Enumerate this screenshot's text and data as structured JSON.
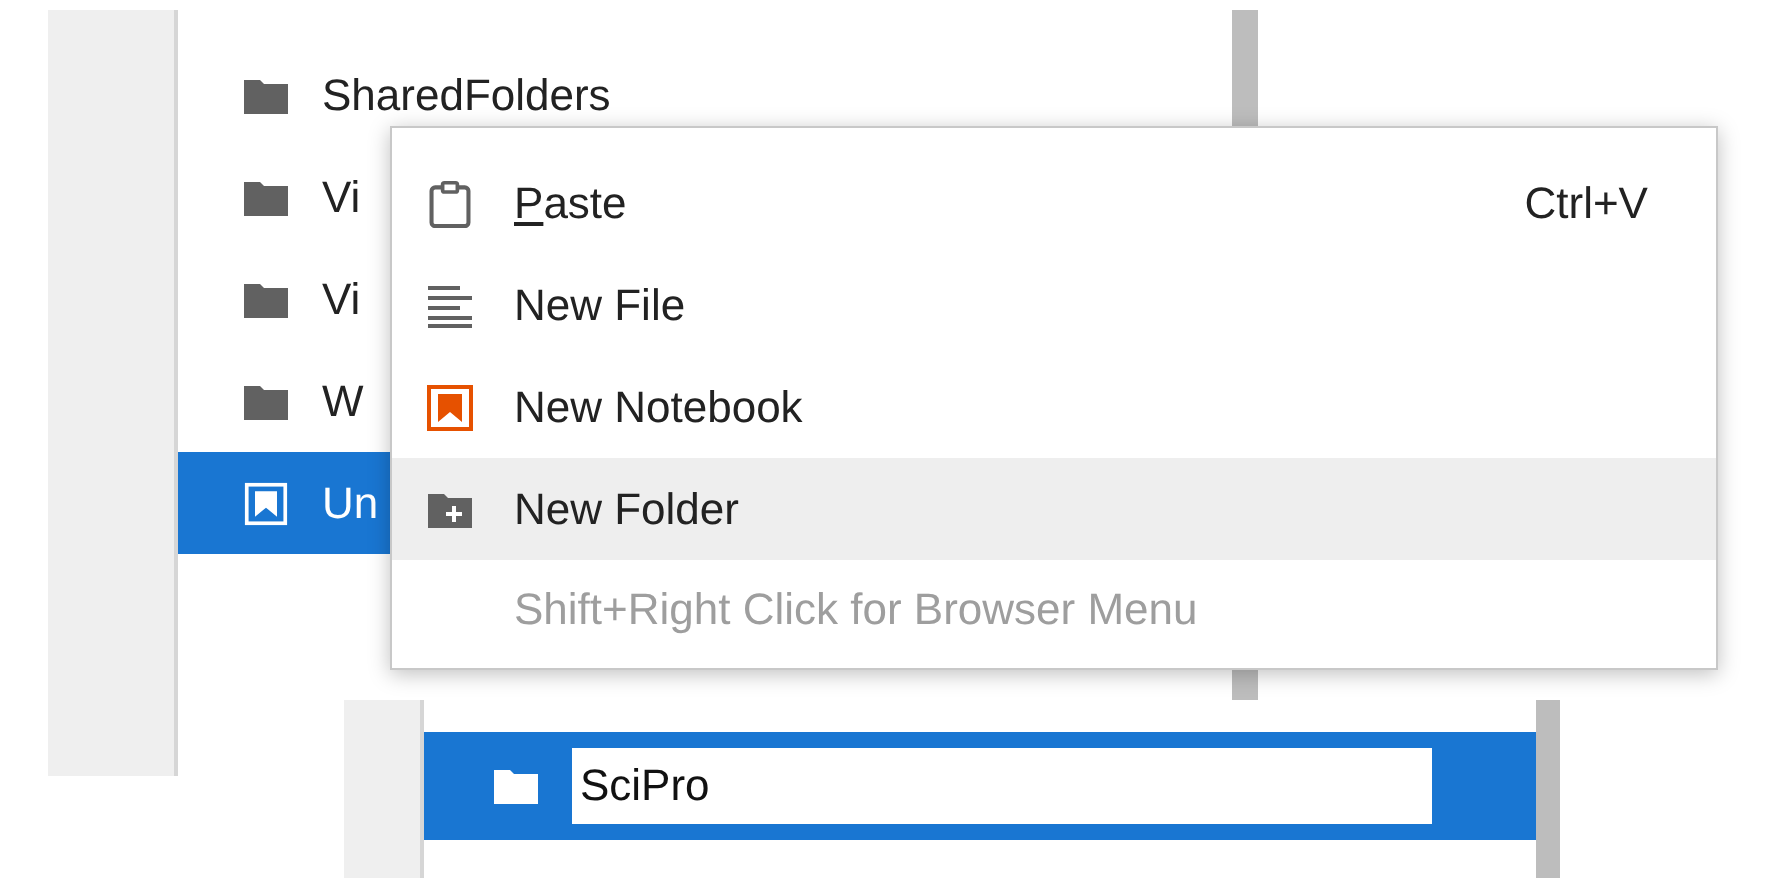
{
  "file_list": {
    "items": [
      {
        "name": "SharedFolders",
        "kind": "folder",
        "selected": false
      },
      {
        "name": "Vi",
        "kind": "folder",
        "selected": false
      },
      {
        "name": "Vi",
        "kind": "folder",
        "selected": false
      },
      {
        "name": "W",
        "kind": "folder",
        "selected": false
      },
      {
        "name": "Un",
        "kind": "notebook",
        "selected": true
      }
    ]
  },
  "context_menu": {
    "items": [
      {
        "label": "Paste",
        "kind": "paste",
        "shortcut": "Ctrl+V",
        "mnemonic_underlined": true,
        "selected": false
      },
      {
        "label": "New File",
        "kind": "file",
        "mnemonic_underlined": false,
        "selected": false
      },
      {
        "label": "New Notebook",
        "kind": "notebook",
        "mnemonic_underlined": false,
        "selected": false
      },
      {
        "label": "New Folder",
        "kind": "folder",
        "mnemonic_underlined": false,
        "selected": true
      }
    ],
    "hint": "Shift+Right Click for Browser Menu"
  },
  "rename_list": {
    "items": [
      {
        "kind": "folder",
        "value": "SciPro",
        "selected": true
      }
    ]
  }
}
